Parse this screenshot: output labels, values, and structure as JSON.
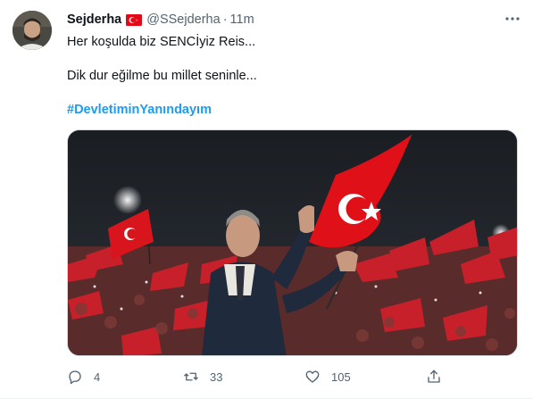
{
  "tweet": {
    "author_name": "Sejderha",
    "handle": "@SSejderha",
    "separator": "·",
    "time": "11m",
    "lines": [
      "Her koşulda biz SENCİyiz Reis...",
      "Dik dur eğilme bu millet seninle..."
    ],
    "hashtag": "#DevletiminYanındayım",
    "flag_icon": "turkey-flag-icon",
    "media_alt": "photo"
  },
  "actions": {
    "replies": "4",
    "retweets": "33",
    "likes": "105"
  },
  "colors": {
    "accent": "#1d9bf0",
    "secondary_text": "#536471",
    "flag_red": "#e30a17"
  }
}
